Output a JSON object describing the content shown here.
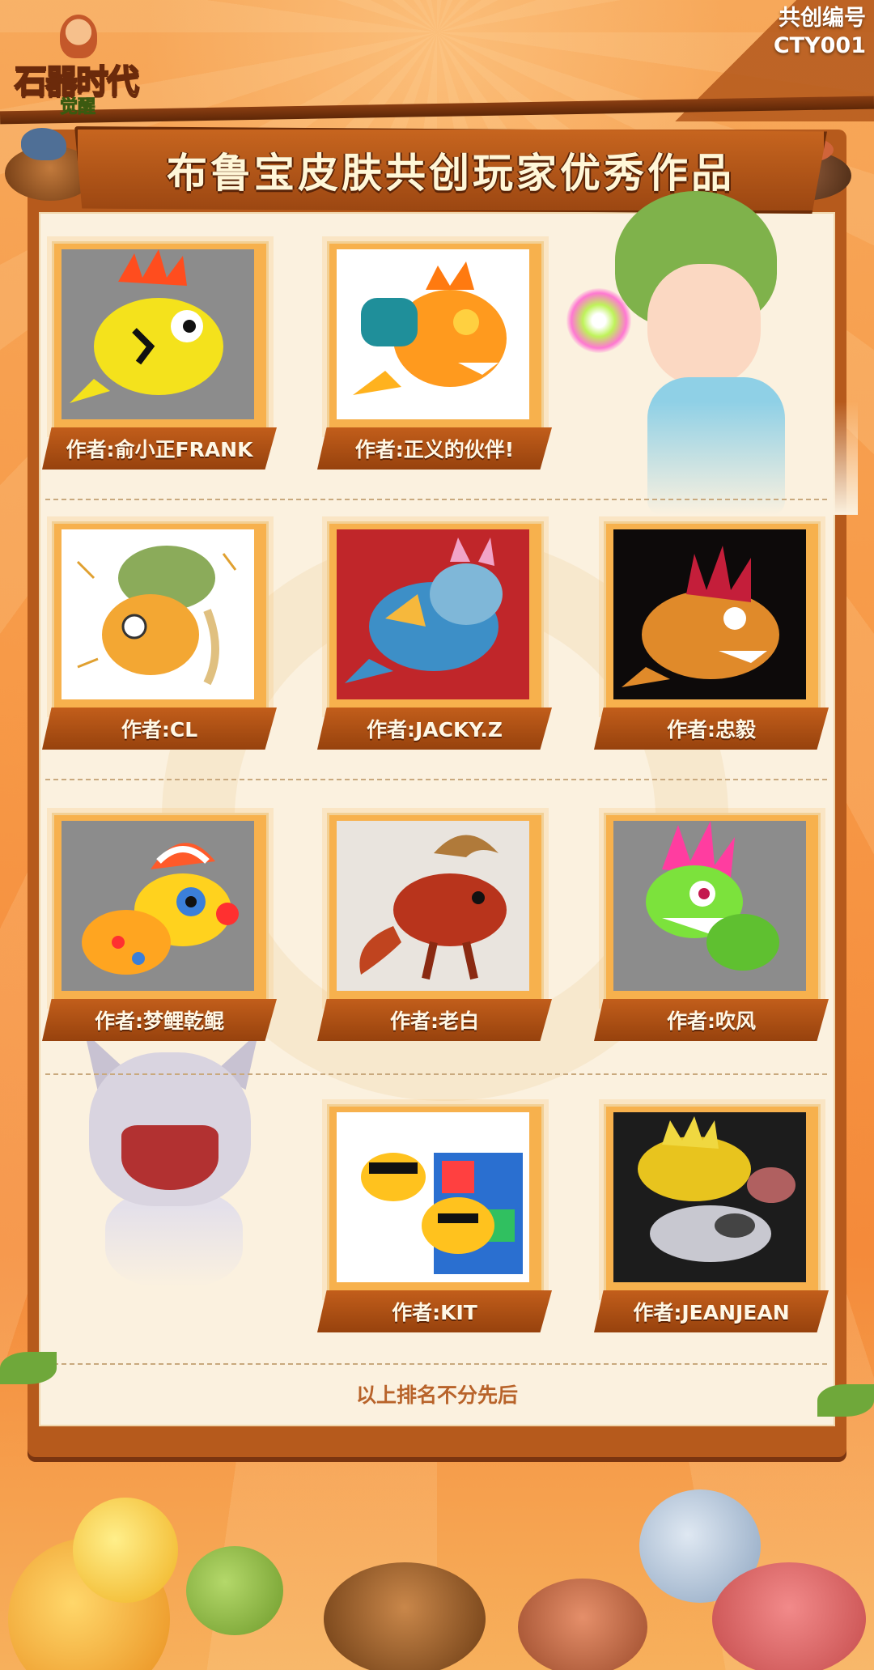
{
  "logo": {
    "main": "石器时代",
    "sub": "觉醒"
  },
  "serial": {
    "line1": "共创编号",
    "line2": "CTY001"
  },
  "title": "布鲁宝皮肤共创玩家优秀作品",
  "works": [
    {
      "label": "作者:俞小正FRANK",
      "art": "flame-yellow-dino"
    },
    {
      "label": "作者:正义的伙伴!",
      "art": "orange-dino-backpack"
    },
    {
      "label": "作者:CL",
      "art": "sketch-dino-bag"
    },
    {
      "label": "作者:JACKY.Z",
      "art": "tiger-armor-dino"
    },
    {
      "label": "作者:忠毅",
      "art": "crystal-dino-dark"
    },
    {
      "label": "作者:梦鲤乾鲲",
      "art": "clown-hat-dino"
    },
    {
      "label": "作者:老白",
      "art": "red-lion-dino"
    },
    {
      "label": "作者:吹风",
      "art": "green-punk-dino"
    },
    {
      "label": "作者:KIT",
      "art": "hiphop-dino-comic"
    },
    {
      "label": "作者:JEANJEAN",
      "art": "golden-robot-dino"
    }
  ],
  "footnote": "以上排名不分先后",
  "colors": {
    "accent": "#c25e1b",
    "paper": "#fbf1df",
    "frame": "#f7b14d",
    "background": "#f79a48"
  }
}
